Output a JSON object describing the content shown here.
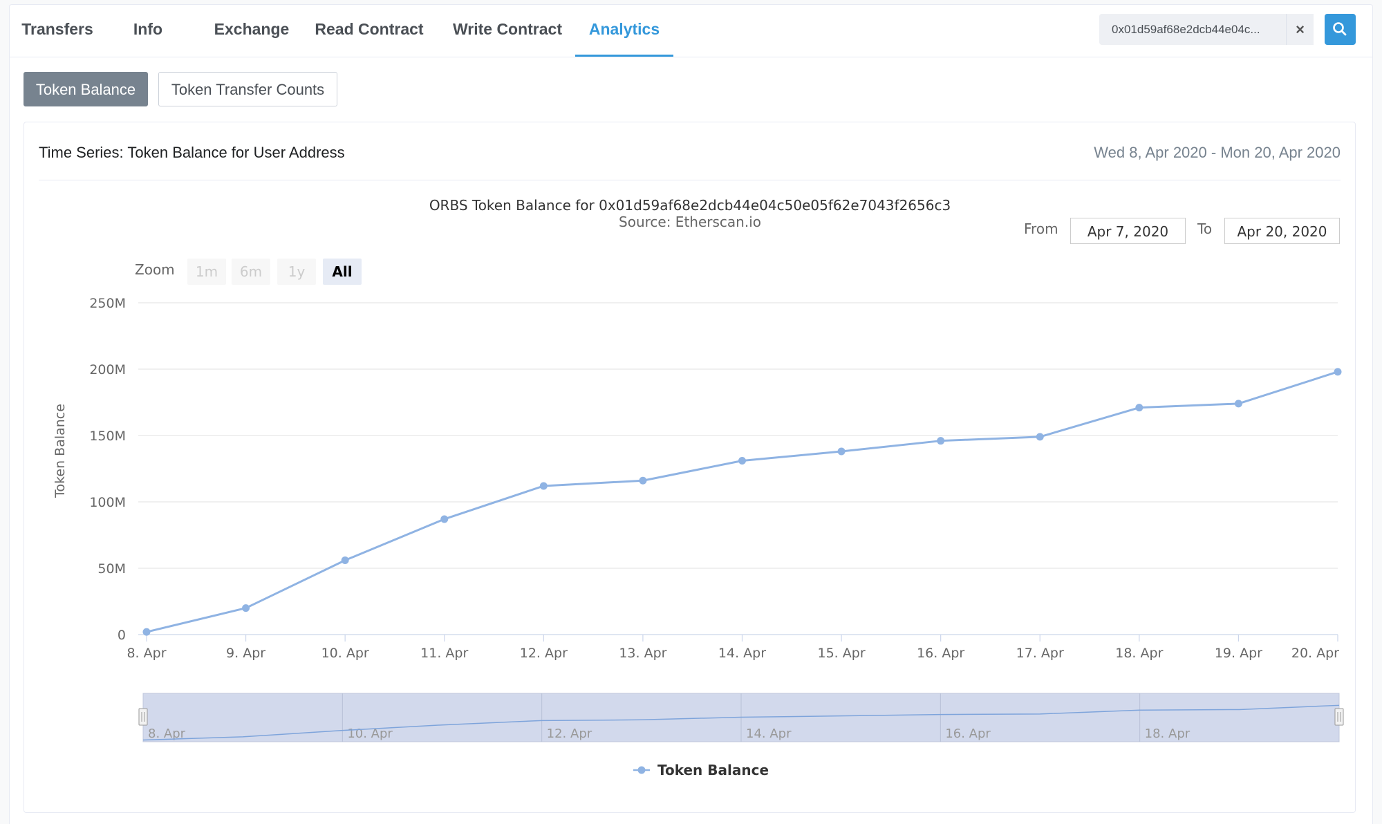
{
  "tabs": [
    {
      "label": "Transfers",
      "active": false
    },
    {
      "label": "Info",
      "active": false
    },
    {
      "label": "Exchange",
      "active": false
    },
    {
      "label": "Read Contract",
      "active": false
    },
    {
      "label": "Write Contract",
      "active": false
    },
    {
      "label": "Analytics",
      "active": true
    }
  ],
  "search": {
    "value": "0x01d59af68e2dcb44e04c...",
    "clear_icon": "close-icon",
    "button_icon": "search-icon"
  },
  "subtabs": {
    "token_balance": "Token Balance",
    "transfer_counts": "Token Transfer Counts"
  },
  "panel": {
    "title": "Time Series: Token Balance for User Address",
    "date_range": "Wed 8, Apr 2020 - Mon 20, Apr 2020"
  },
  "zoom": {
    "label": "Zoom",
    "options": [
      "1m",
      "6m",
      "1y",
      "All"
    ],
    "selected": "All"
  },
  "range": {
    "from_label": "From",
    "from_value": "Apr 7, 2020",
    "to_label": "To",
    "to_value": "Apr 20, 2020"
  },
  "colors": {
    "accent": "#3498db",
    "series": "#8fb3e3",
    "navigator_fill": "#d2d9ec"
  },
  "chart_data": {
    "type": "line",
    "title": "ORBS Token Balance for 0x01d59af68e2dcb44e04c50e05f62e7043f2656c3",
    "subtitle": "Source: Etherscan.io",
    "ylabel": "Token Balance",
    "xlabel": "",
    "ylim": [
      0,
      250000000
    ],
    "y_ticks": [
      0,
      50000000,
      100000000,
      150000000,
      200000000,
      250000000
    ],
    "y_tick_labels": [
      "0",
      "50M",
      "100M",
      "150M",
      "200M",
      "250M"
    ],
    "categories": [
      "8. Apr",
      "9. Apr",
      "10. Apr",
      "11. Apr",
      "12. Apr",
      "13. Apr",
      "14. Apr",
      "15. Apr",
      "16. Apr",
      "17. Apr",
      "18. Apr",
      "19. Apr",
      "20. Apr"
    ],
    "series": [
      {
        "name": "Token Balance",
        "values": [
          2000000,
          20000000,
          56000000,
          87000000,
          112000000,
          116000000,
          131000000,
          138000000,
          146000000,
          149000000,
          171000000,
          174000000,
          198000000
        ]
      }
    ],
    "navigator_ticks": [
      "8. Apr",
      "10. Apr",
      "12. Apr",
      "14. Apr",
      "16. Apr",
      "18. Apr"
    ],
    "grid": true,
    "legend": "bottom-center"
  }
}
